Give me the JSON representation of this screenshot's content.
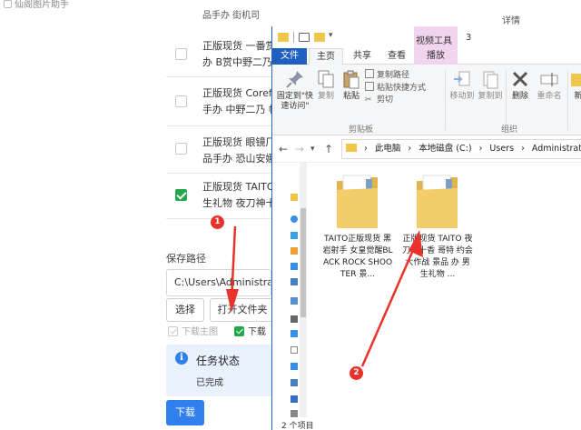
{
  "app": {
    "title": "仙阁图片助手",
    "partial_row_text": "品手办 街机司",
    "partial_right_text": "详情",
    "rows": [
      {
        "line1": "正版现货 一番赏",
        "line2": "办 B赏中野二乃",
        "checked": false
      },
      {
        "line1": "正版现货 Corefu",
        "line2": "手办 中野二乃 帷",
        "checked": false
      },
      {
        "line1": "正版现货 眼镜厂",
        "line2": "品手办 恐山安娜",
        "checked": false
      },
      {
        "line1": "正版现货 TAITO",
        "line2": "生礼物 夜刀神十",
        "checked": true
      }
    ],
    "save_path_label": "保存路径",
    "save_path_value": "C:\\Users\\Administrator",
    "choose_button": "选择",
    "open_folder_button": "打开文件夹",
    "option_download_main": "下载主图",
    "option_download_detail": "下载",
    "status_title": "任务状态",
    "status_text": "已完成",
    "download_button": "下载"
  },
  "explorer": {
    "contextual_group": "视频工具",
    "window_count": "3",
    "tabs": {
      "file": "文件",
      "home": "主页",
      "share": "共享",
      "view": "查看",
      "play": "播放"
    },
    "ribbon": {
      "pin_label_1": "固定到\"快",
      "pin_label_2": "速访问\"",
      "copy": "复制",
      "paste": "粘贴",
      "copy_path": "复制路径",
      "paste_shortcut": "粘贴快捷方式",
      "cut": "剪切",
      "clipboard_group": "剪贴板",
      "move_to": "移动到",
      "copy_to": "复制到",
      "delete": "删除",
      "rename": "重命名",
      "organize_group": "组织",
      "new_partial": "新"
    },
    "address": {
      "this_pc": "此电脑",
      "drive": "本地磁盘 (C:)",
      "users": "Users",
      "admin": "Administrator"
    },
    "folders": [
      {
        "name": "TAITO正版现货 黑岩射手 女皇觉醒BLACK ROCK SHOOTER 景..."
      },
      {
        "name": "正版现货 TAITO 夜刀神十香 哥特 约会大作战 景品 办 男生礼物 ..."
      }
    ],
    "status_count": "2 个项目"
  },
  "annotations": {
    "badge1": "1",
    "badge2": "2",
    "color": "#e8322a"
  },
  "colors": {
    "accent": "#2f80ed",
    "check_green": "#23a849",
    "file_tab": "#1f5fbf",
    "context_tab": "#f3d4ef"
  }
}
